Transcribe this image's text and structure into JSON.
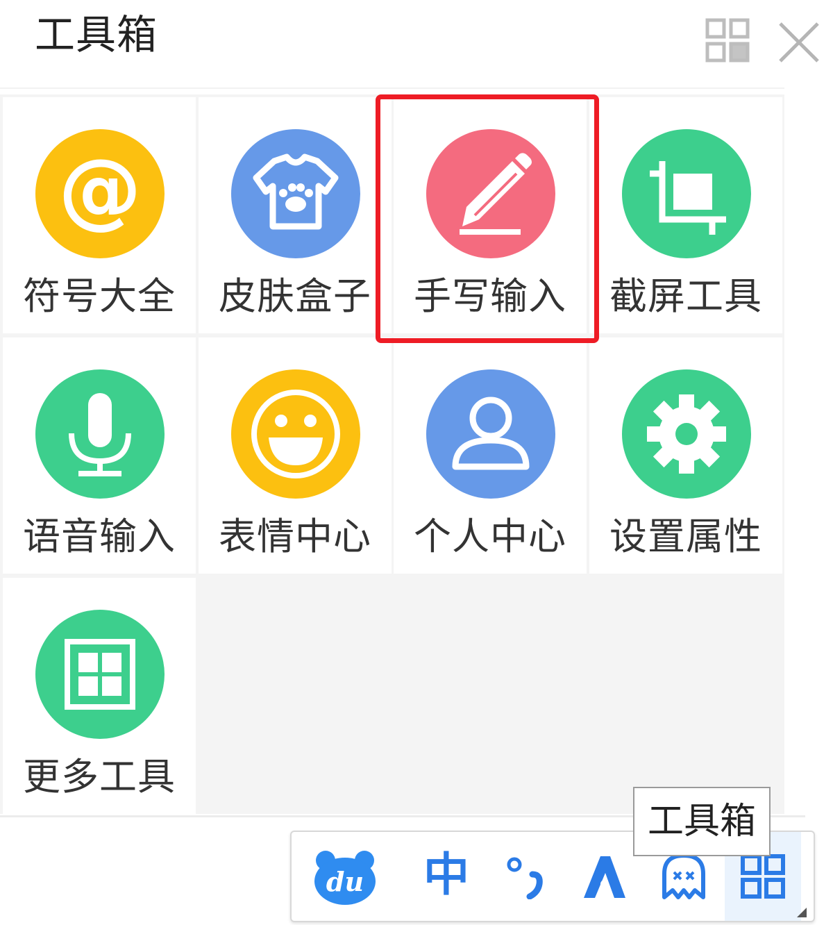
{
  "panel": {
    "title": "工具箱"
  },
  "tools": [
    {
      "label": "符号大全",
      "icon": "at-sign-icon",
      "color": "#fcc010"
    },
    {
      "label": "皮肤盒子",
      "icon": "tshirt-paw-icon",
      "color": "#6699e8"
    },
    {
      "label": "手写输入",
      "icon": "pencil-icon",
      "color": "#f46b7f"
    },
    {
      "label": "截屏工具",
      "icon": "crop-icon",
      "color": "#3dcf8d"
    },
    {
      "label": "语音输入",
      "icon": "microphone-icon",
      "color": "#3dcf8d"
    },
    {
      "label": "表情中心",
      "icon": "smiley-icon",
      "color": "#fcc010"
    },
    {
      "label": "个人中心",
      "icon": "user-icon",
      "color": "#6699e8"
    },
    {
      "label": "设置属性",
      "icon": "gear-icon",
      "color": "#3dcf8d"
    },
    {
      "label": "更多工具",
      "icon": "grid-icon",
      "color": "#3dcf8d"
    }
  ],
  "statusbar": {
    "logo_text": "du",
    "mode_label": "中",
    "accent": "#2b7be6"
  },
  "tooltip": {
    "text": "工具箱"
  }
}
